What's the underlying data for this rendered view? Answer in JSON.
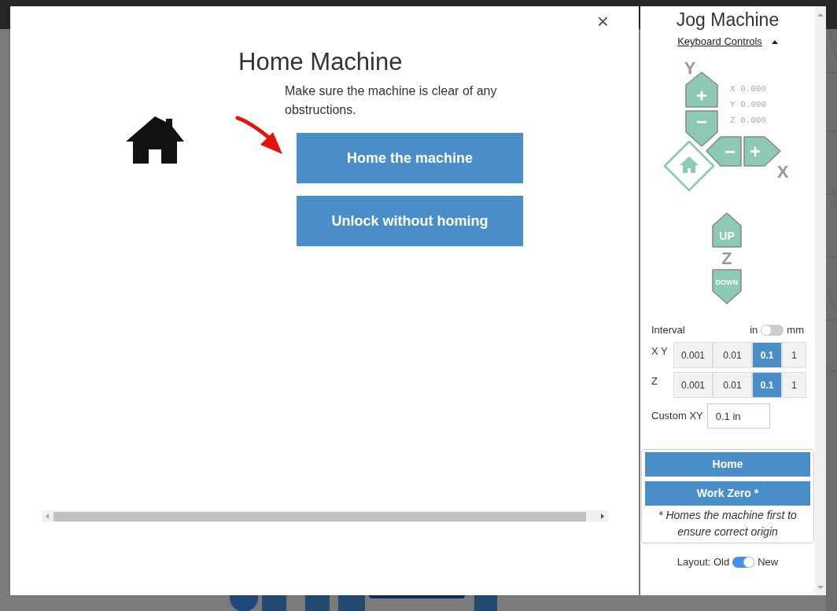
{
  "dialog": {
    "title": "Home Machine",
    "close": "×",
    "message": "Make sure the machine is clear of any obstructions.",
    "buttons": [
      "Home the machine",
      "Unlock without homing"
    ]
  },
  "jog": {
    "title": "Jog Machine",
    "keyboard_controls": {
      "label": "Keyboard Controls",
      "expanded": true
    },
    "axes": {
      "y": "Y",
      "x": "X",
      "z": "Z"
    },
    "buttons": [
      {
        "kind": "y_plus",
        "label": "+"
      },
      {
        "kind": "y_minus",
        "label": "−"
      },
      {
        "kind": "x_minus",
        "label": "−"
      },
      {
        "kind": "x_plus",
        "label": "+"
      },
      {
        "kind": "home"
      },
      {
        "kind": "z_up",
        "label": "UP"
      },
      {
        "kind": "z_down",
        "label": "DOWN"
      }
    ],
    "position": [
      {
        "axis": "X",
        "value": "0.000"
      },
      {
        "axis": "Y",
        "value": "0.000"
      },
      {
        "axis": "Z",
        "value": "0.000"
      }
    ],
    "interval": {
      "label": "Interval",
      "unit_left": "in",
      "unit_right": "mm",
      "mm": false,
      "rows": [
        {
          "axis": "X Y",
          "options": [
            {
              "label": "0.001",
              "selected": false
            },
            {
              "label": "0.01",
              "selected": false
            },
            {
              "label": "0.1",
              "selected": true
            },
            {
              "label": "1",
              "selected": false
            }
          ]
        },
        {
          "axis": "Z",
          "options": [
            {
              "label": "0.001",
              "selected": false
            },
            {
              "label": "0.01",
              "selected": false
            },
            {
              "label": "0.1",
              "selected": true
            },
            {
              "label": "1",
              "selected": false
            }
          ]
        }
      ]
    },
    "custom": {
      "label": "Custom XY",
      "value": "0.1 in"
    },
    "home": "Home",
    "work_zero": "Work Zero *",
    "note": "* Homes the machine first to ensure correct origin",
    "layout": {
      "label": "Layout: Old",
      "new_label": "New",
      "on": true
    }
  }
}
